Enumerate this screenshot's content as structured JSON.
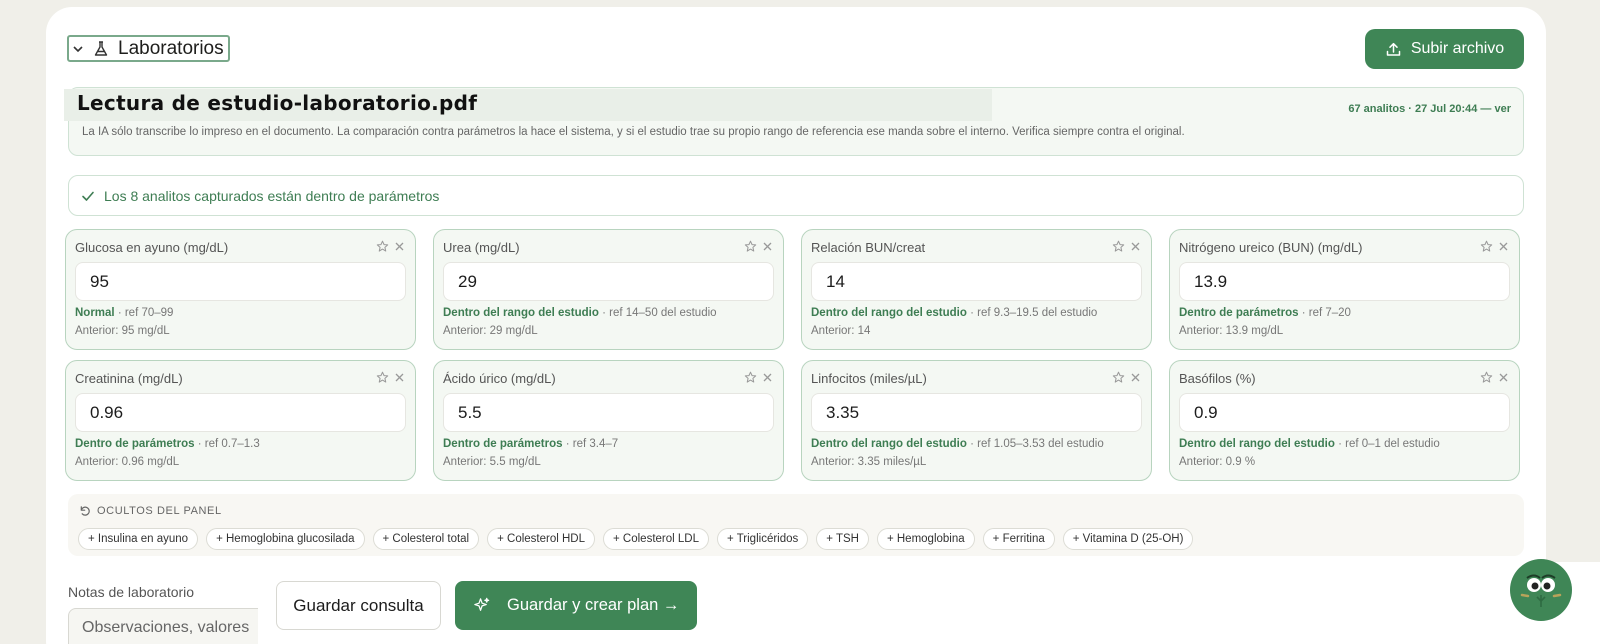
{
  "section": {
    "title": "Laboratorios"
  },
  "upload": {
    "label": "Subir archivo"
  },
  "file": {
    "title": "Lectura de estudio-laboratorio.pdf",
    "meta": "67 analitos · 27 Jul 20:44 — ver",
    "note": "La IA sólo transcribe lo impreso en el documento. La comparación contra parámetros la hace el sistema, y si el estudio trae su propio rango de referencia ese manda sobre el interno. Verifica siempre contra el original."
  },
  "banner": {
    "text": "Los 8 analitos capturados están dentro de parámetros"
  },
  "analytes": [
    {
      "label": "Glucosa en ayuno (mg/dL)",
      "value": "95",
      "status": "Normal",
      "ref": " · ref 70–99",
      "prev": "Anterior: 95 mg/dL"
    },
    {
      "label": "Urea (mg/dL)",
      "value": "29",
      "status": "Dentro del rango del estudio",
      "ref": " · ref 14–50 del estudio",
      "prev": "Anterior: 29 mg/dL"
    },
    {
      "label": "Relación BUN/creat",
      "value": "14",
      "status": "Dentro del rango del estudio",
      "ref": " · ref 9.3–19.5 del estudio",
      "prev": "Anterior: 14"
    },
    {
      "label": "Nitrógeno ureico (BUN) (mg/dL)",
      "value": "13.9",
      "status": "Dentro de parámetros",
      "ref": " · ref 7–20",
      "prev": "Anterior: 13.9 mg/dL"
    },
    {
      "label": "Creatinina (mg/dL)",
      "value": "0.96",
      "status": "Dentro de parámetros",
      "ref": " · ref 0.7–1.3",
      "prev": "Anterior: 0.96 mg/dL"
    },
    {
      "label": "Ácido úrico (mg/dL)",
      "value": "5.5",
      "status": "Dentro de parámetros",
      "ref": " · ref 3.4–7",
      "prev": "Anterior: 5.5 mg/dL"
    },
    {
      "label": "Linfocitos (miles/µL)",
      "value": "3.35",
      "status": "Dentro del rango del estudio",
      "ref": " · ref 1.05–3.53 del estudio",
      "prev": "Anterior: 3.35 miles/µL"
    },
    {
      "label": "Basófilos (%)",
      "value": "0.9",
      "status": "Dentro del rango del estudio",
      "ref": " · ref 0–1 del estudio",
      "prev": "Anterior: 0.9 %"
    }
  ],
  "hidden": {
    "title": "OCULTOS DEL PANEL",
    "chips": [
      "+ Insulina en ayuno",
      "+ Hemoglobina glucosilada",
      "+ Colesterol total",
      "+ Colesterol HDL",
      "+ Colesterol LDL",
      "+ Triglicéridos",
      "+ TSH",
      "+ Hemoglobina",
      "+ Ferritina",
      "+ Vitamina D (25-OH)"
    ]
  },
  "notes": {
    "label": "Notas de laboratorio",
    "placeholder": "Observaciones, valores"
  },
  "actions": {
    "save": "Guardar consulta",
    "plan": "Guardar y crear plan →"
  },
  "colors": {
    "accent": "#3f8656",
    "accent_text": "#3e7d53",
    "card_bg": "#f4f8f3",
    "card_border": "#b8d4bf",
    "page_bg": "#f0efe9"
  }
}
